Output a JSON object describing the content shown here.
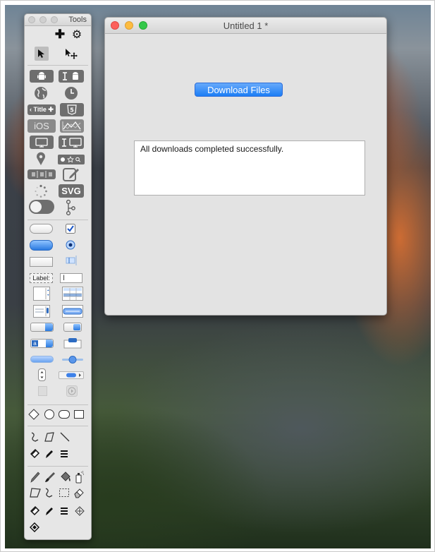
{
  "tools_palette": {
    "title": "Tools",
    "add_glyph": "✚",
    "settings_glyph": "⚙",
    "title_button_label": "‹ Title ✚",
    "html5_label": "5",
    "ios_label": "iOS",
    "svg_label": "SVG",
    "label_control": "Label:"
  },
  "main_window": {
    "title": "Untitled 1 *",
    "download_button_label": "Download Files",
    "status_text": "All downloads completed successfully."
  },
  "colors": {
    "accent_blue": "#1c7ef5",
    "close_red": "#fc605b",
    "minimize_yellow": "#fdbc40",
    "zoom_green": "#34c84a"
  }
}
